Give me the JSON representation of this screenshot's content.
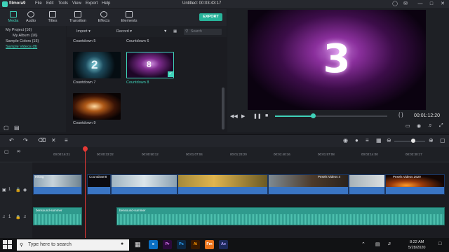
{
  "titlebar": {
    "brand": "filmora9",
    "menus": [
      "File",
      "Edit",
      "Tools",
      "View",
      "Export",
      "Help"
    ],
    "title": "Untitled:  00:03:43:17"
  },
  "media_tabs": [
    {
      "label": "Media",
      "icon": "folder-icon",
      "active": true
    },
    {
      "label": "Audio",
      "icon": "music-note-icon"
    },
    {
      "label": "Titles",
      "icon": "text-icon"
    },
    {
      "label": "Transition",
      "icon": "transition-icon"
    },
    {
      "label": "Effects",
      "icon": "effects-icon"
    },
    {
      "label": "Elements",
      "icon": "image-icon"
    }
  ],
  "export_label": "EXPORT",
  "tree": {
    "items": [
      {
        "label": "My Project (16)"
      },
      {
        "label": "My Album (16)",
        "sub": true
      },
      {
        "label": "Sample Colors (15)"
      },
      {
        "label": "Sample Videos (8)",
        "active": true
      }
    ]
  },
  "media_bar": {
    "import": "Import",
    "record": "Record",
    "search_placeholder": "Search"
  },
  "media_items": [
    {
      "label": "Countdown 5"
    },
    {
      "label": "Countdown 6"
    },
    {
      "label": "Countdown 7"
    },
    {
      "label": "Countdown 8",
      "selected": true
    },
    {
      "label": "Countdown 9"
    }
  ],
  "preview": {
    "number": "3",
    "progress": 0.34,
    "time": "00:01:12:20",
    "braces": "{  }"
  },
  "ruler_ticks": [
    "00:00:00:00",
    "00:00:16:21",
    "00:00:33:22",
    "00:00:50:12",
    "00:01:07:04",
    "00:01:23:20",
    "00:01:40:16",
    "00:01:57:08",
    "00:02:14:00",
    "00:02:30:17",
    "00:02:47:09",
    "00:03:04:01"
  ],
  "tracks": {
    "video_label": "1",
    "audio_label": "1",
    "video_clips": [
      {
        "label": "Hiking"
      },
      {
        "label": "Countdown8"
      },
      {
        "label": ""
      },
      {
        "label": ""
      },
      {
        "label": "Pexels Videos 4"
      },
      {
        "label": ""
      },
      {
        "label": "Pexels Videos 2629"
      }
    ],
    "audio_clips": [
      {
        "label": "bensound-summer"
      },
      {
        "label": "bensound-summer"
      }
    ]
  },
  "taskbar": {
    "search_placeholder": "Type here to search",
    "apps": [
      "e",
      "Pr",
      "Ps",
      "Ai",
      "Fm",
      "Ae"
    ],
    "time": "8:22 AM",
    "date": "5/28/2020"
  },
  "colors": {
    "accent": "#3fd2b9",
    "playhead": "#e53935",
    "video_clip": "#2a5c9f",
    "audio_clip": "#2f9a8d"
  }
}
